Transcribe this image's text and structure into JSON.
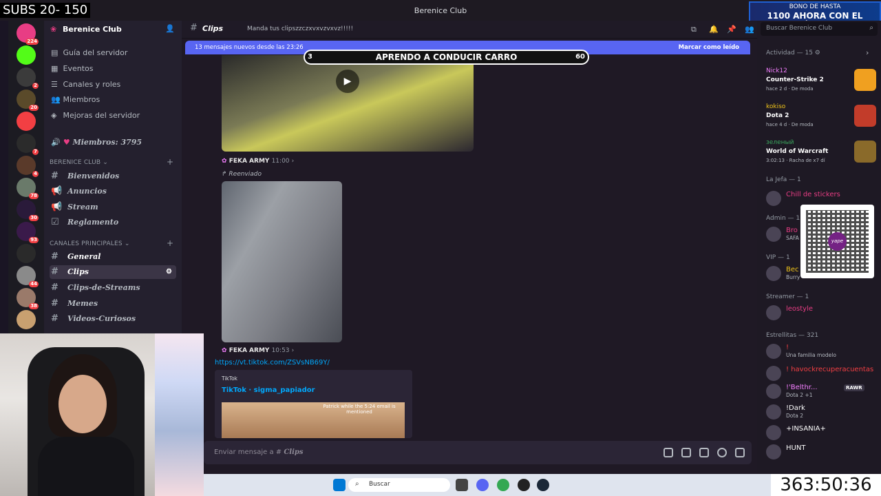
{
  "overlay": {
    "subs": "SUBS 20- 150",
    "promo_line1": "BONO DE HASTA",
    "promo_line2": "1100 AHORA CON EL CÓDIGO",
    "stream_title": "APRENDO A CONDUCIR CARRO",
    "stream_left_num": "3",
    "stream_right_num": "60",
    "timer": "363:50:36"
  },
  "window": {
    "title": "Berenice Club"
  },
  "servers": [
    {
      "badge": "224",
      "color": "#e83d84"
    },
    {
      "badge": "",
      "color": "#53fc18"
    },
    {
      "badge": "2",
      "color": "#3b3b3b"
    },
    {
      "badge": "20",
      "color": "#5a4a2a"
    },
    {
      "badge": "",
      "color": "#f23f43"
    },
    {
      "badge": "7",
      "color": "#2b2b2b"
    },
    {
      "badge": "4",
      "color": "#5a3a2a"
    },
    {
      "badge": "78",
      "color": "#6a7a6a"
    },
    {
      "badge": "30",
      "color": "#2a1a3a"
    },
    {
      "badge": "93",
      "color": "#3a1a4a"
    },
    {
      "badge": "",
      "color": "#2a2a2a"
    },
    {
      "badge": "44",
      "color": "#8a8a8a"
    },
    {
      "badge": "38",
      "color": "#9a7a6a"
    },
    {
      "badge": "",
      "color": "#c8a070"
    }
  ],
  "sidebar": {
    "server_name": "Berenice Club",
    "nav": [
      "Guía del servidor",
      "Eventos",
      "Canales y roles",
      "Miembros",
      "Mejoras del servidor"
    ],
    "members_channel": "Miembros: 3795",
    "category1": "BERENICE CLUB",
    "channels1": [
      "Bienvenidos",
      "Anuncios",
      "Stream",
      "Reglamento"
    ],
    "category2": "CANALES PRINCIPALES",
    "channels2": [
      "General",
      "Clips",
      "Clips-de-Streams",
      "Memes",
      "Videos-Curiosos"
    ]
  },
  "chat": {
    "channel_name": "Clips",
    "topic": "Manda tus clipszzczxvxvzvxvz!!!!!",
    "new_messages": "13 mensajes nuevos desde las 23:26",
    "mark_read": "Marcar como leído",
    "msg1_author": "FEKA ARMY",
    "msg1_time": "11:00",
    "forwarded": "Reenviado",
    "msg2_author": "FEKA ARMY",
    "msg2_time": "10:53",
    "link": "https://vt.tiktok.com/ZSVsNB69Y/",
    "embed_provider": "TikTok",
    "embed_title": "TikTok · sigma_papiador",
    "embed_caption": "Patrick while the 5:24 email is mentioned",
    "composer_placeholder": "Enviar mensaje a #",
    "composer_channel": "Clips"
  },
  "members": {
    "search_placeholder": "Buscar Berenice Club",
    "activity_header": "Actividad — 15",
    "activities": [
      {
        "user": "Nick12",
        "game": "Counter-Strike 2",
        "meta": "hace 2 d · De moda",
        "user_color": "#f47fff",
        "icon_color": "#f0a020"
      },
      {
        "user": "kokiso",
        "game": "Dota 2",
        "meta": "hace 4 d · De moda",
        "user_color": "#f0c419",
        "icon_color": "#c23c2a"
      },
      {
        "user": "зеленый",
        "game": "World of Warcraft",
        "meta": "3:02:13 · Racha de x7 dí",
        "user_color": "#3ba55d",
        "icon_color": "#8a6a2a"
      }
    ],
    "groups": [
      {
        "label": "La Jefa — 1",
        "members": [
          {
            "name": "Chill de stickers",
            "sub": "",
            "color": "#e83d84"
          }
        ]
      },
      {
        "label": "Admin — 1",
        "members": [
          {
            "name": "Bro",
            "sub": "SAFA",
            "color": "#e83d84"
          }
        ]
      },
      {
        "label": "VIP — 1",
        "members": [
          {
            "name": "Bec",
            "sub": "Burry",
            "color": "#f0c419"
          }
        ]
      },
      {
        "label": "Streamer — 1",
        "members": [
          {
            "name": "leostyle",
            "sub": "",
            "color": "#e83d84"
          }
        ]
      },
      {
        "label": "Estrellitas — 321",
        "members": [
          {
            "name": "!",
            "sub": "Una familia modelo",
            "color": "#f23f43"
          },
          {
            "name": "! havockrecuperacuentas",
            "sub": "",
            "color": "#f23f43"
          },
          {
            "name": "!'Belthr...",
            "sub": "Dota 2 +1",
            "color": "#f47fff"
          },
          {
            "name": "!Dark",
            "sub": "Dota 2",
            "color": "#ffffff"
          },
          {
            "name": "+INSANIA+",
            "sub": "",
            "color": "#ffffff"
          },
          {
            "name": "HUNT",
            "sub": "",
            "color": "#ffffff"
          }
        ]
      }
    ],
    "rawr_badge": "RAWR"
  },
  "taskbar": {
    "search": "Buscar"
  }
}
